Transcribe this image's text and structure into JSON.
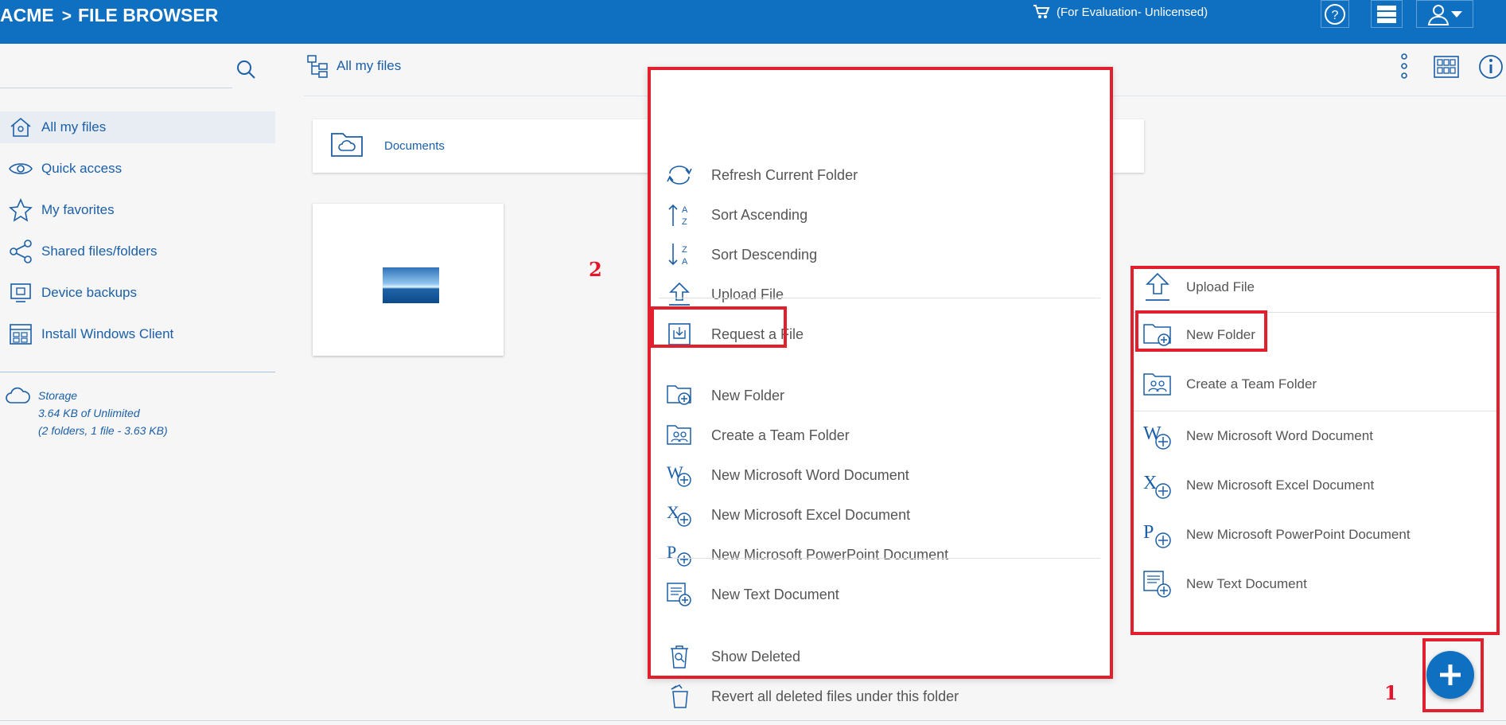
{
  "header": {
    "brand": "ACME",
    "separator": ">",
    "title": "FILE BROWSER",
    "license_text": "(For Evaluation- Unlicensed)"
  },
  "sidebar": {
    "items": [
      {
        "label": "All my files",
        "icon": "home-icon",
        "active": true
      },
      {
        "label": "Quick access",
        "icon": "eye-icon"
      },
      {
        "label": "My favorites",
        "icon": "star-icon"
      },
      {
        "label": "Shared files/folders",
        "icon": "share-icon"
      },
      {
        "label": "Device backups",
        "icon": "device-backup-icon"
      },
      {
        "label": "Install Windows Client",
        "icon": "windows-client-icon"
      }
    ],
    "storage": {
      "title": "Storage",
      "usage": "3.64 KB of Unlimited",
      "details": "(2 folders, 1 file - 3.63 KB)"
    }
  },
  "breadcrumb": {
    "label": "All my files"
  },
  "files": {
    "folder_name": "Documents"
  },
  "annotations": {
    "menu_marker": "2",
    "fab_marker": "1"
  },
  "context_menu": {
    "items": [
      {
        "label": "Refresh Current Folder",
        "icon": "refresh-icon"
      },
      {
        "label": "Sort Ascending",
        "icon": "sort-ascending-icon"
      },
      {
        "label": "Sort Descending",
        "icon": "sort-descending-icon"
      },
      {
        "label": "Upload File",
        "icon": "upload-icon"
      },
      {
        "label": "Request a File",
        "icon": "request-file-icon"
      },
      {
        "label": "New Folder",
        "icon": "new-folder-icon"
      },
      {
        "label": "Create a Team Folder",
        "icon": "team-folder-icon"
      },
      {
        "label": "New Microsoft Word Document",
        "icon": "word-icon"
      },
      {
        "label": "New Microsoft Excel Document",
        "icon": "excel-icon"
      },
      {
        "label": "New Microsoft PowerPoint Document",
        "icon": "powerpoint-icon"
      },
      {
        "label": "New Text Document",
        "icon": "text-doc-icon"
      },
      {
        "label": "Show Deleted",
        "icon": "show-deleted-icon"
      },
      {
        "label": "Revert all deleted files under this folder",
        "icon": "revert-deleted-icon"
      }
    ]
  },
  "fab_menu": {
    "items": [
      {
        "label": "Upload File",
        "icon": "upload-icon"
      },
      {
        "label": "New Folder",
        "icon": "new-folder-icon"
      },
      {
        "label": "Create a Team Folder",
        "icon": "team-folder-icon"
      },
      {
        "label": "New Microsoft Word Document",
        "icon": "word-icon"
      },
      {
        "label": "New Microsoft Excel Document",
        "icon": "excel-icon"
      },
      {
        "label": "New Microsoft PowerPoint Document",
        "icon": "powerpoint-icon"
      },
      {
        "label": "New Text Document",
        "icon": "text-doc-icon"
      }
    ]
  },
  "colors": {
    "brand": "#0f6fc0",
    "highlight": "#e11f2d",
    "link": "#1b5fa8"
  }
}
